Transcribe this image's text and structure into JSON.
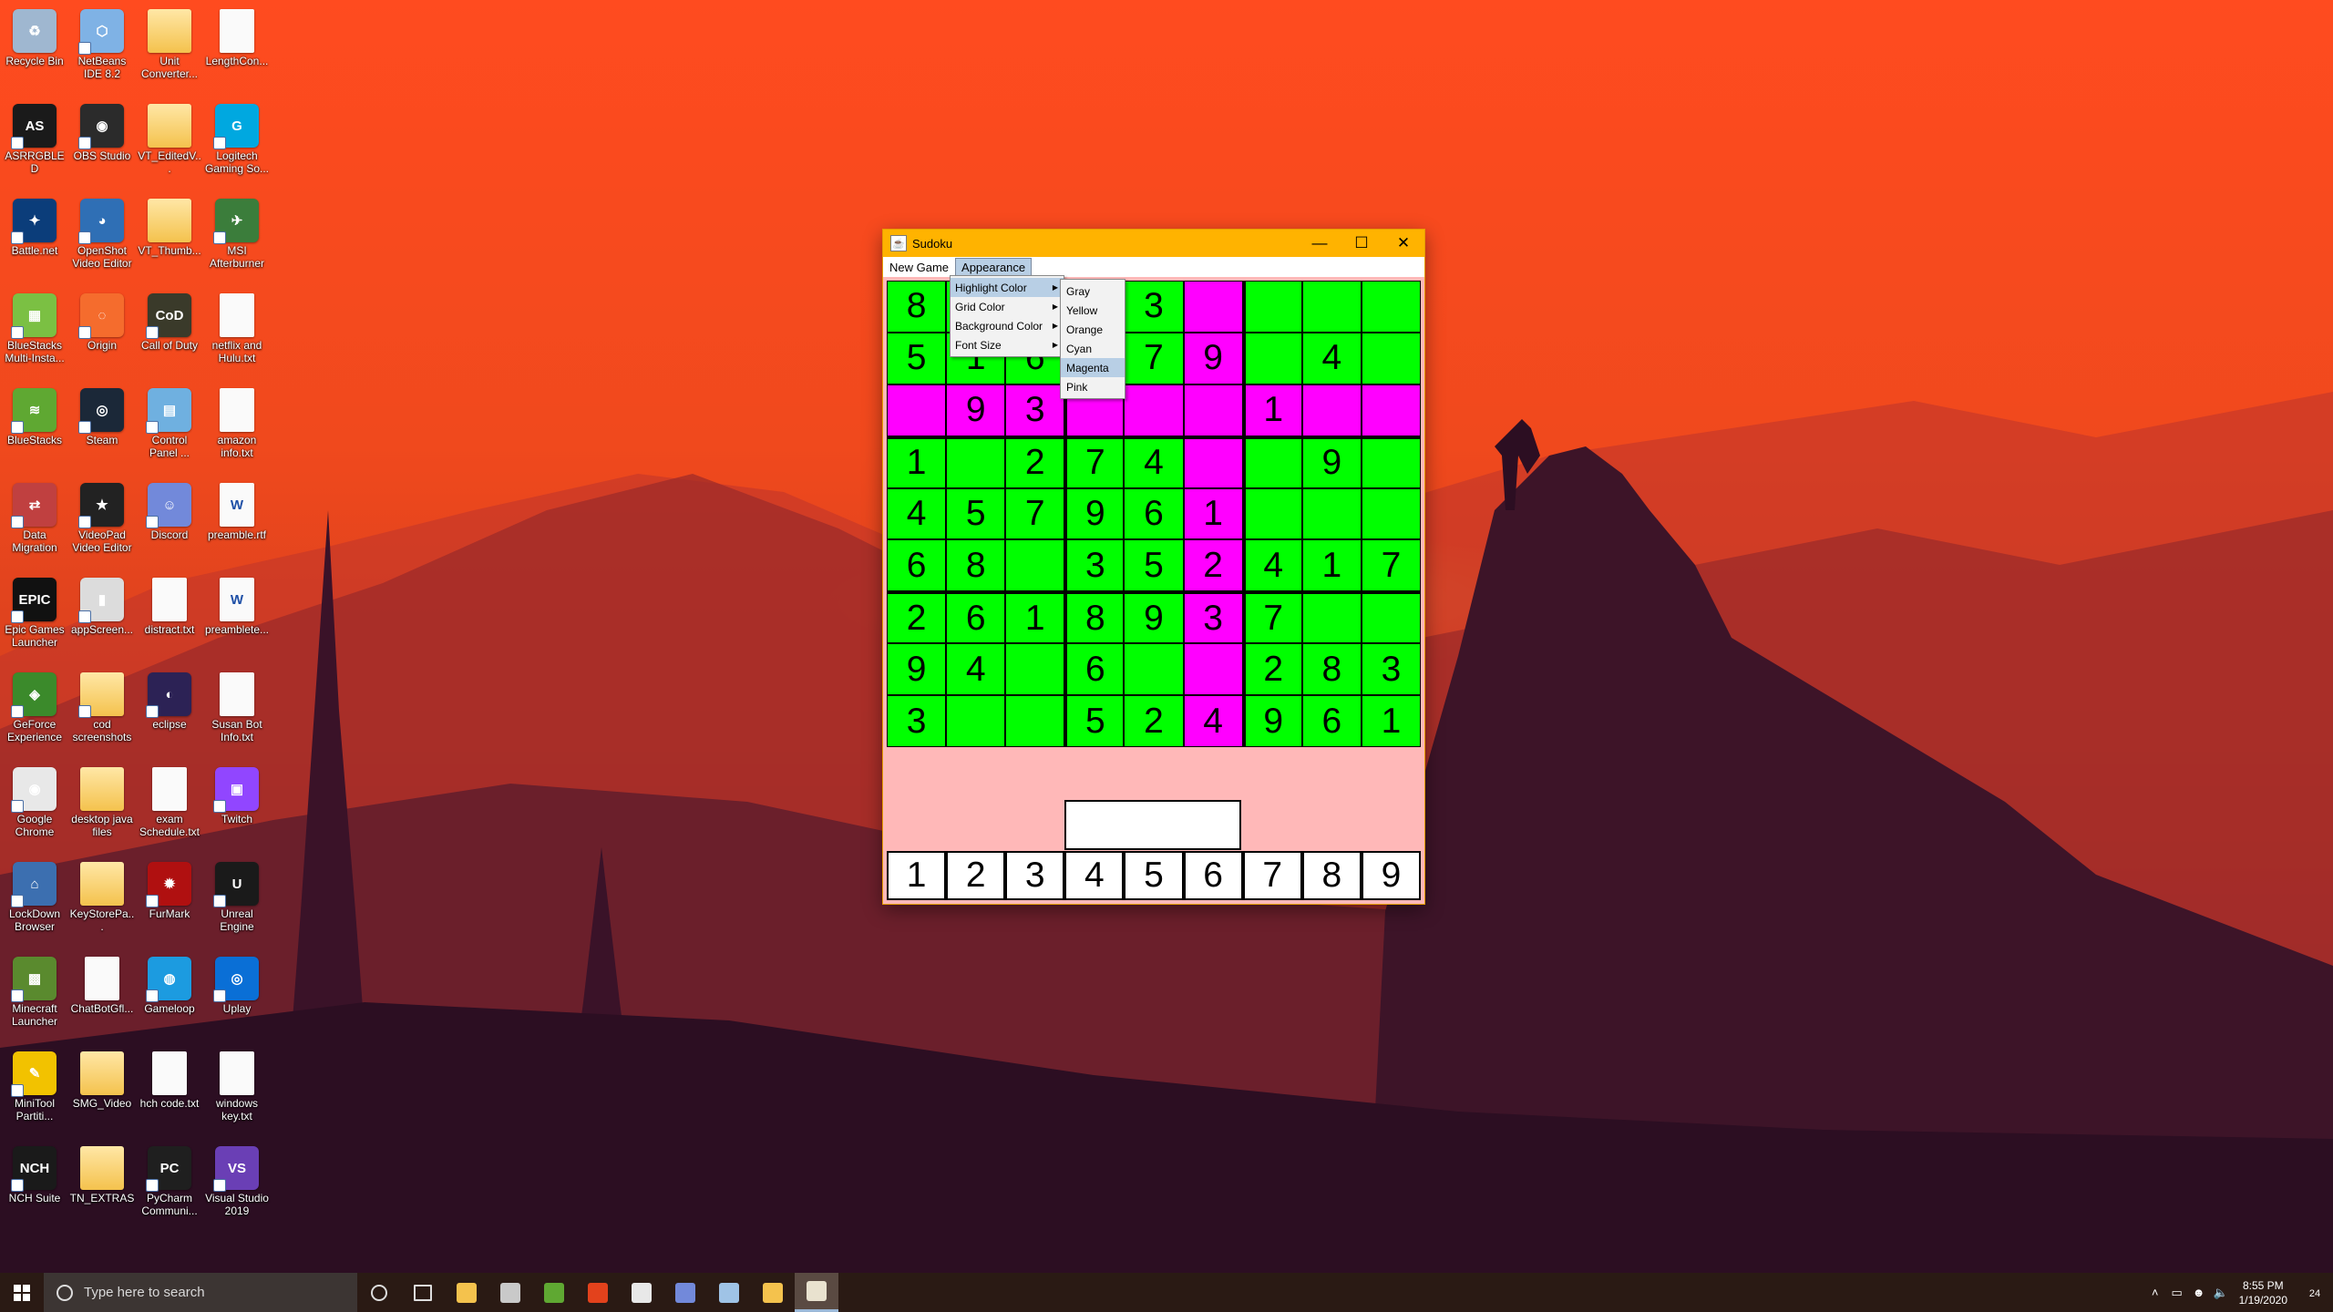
{
  "desktop_icons": [
    {
      "label": "Recycle Bin",
      "color": "#9fb7d0",
      "glyph": "♻",
      "shortcut": false
    },
    {
      "label": "NetBeans IDE 8.2",
      "color": "#7fb2e5",
      "glyph": "⬡",
      "shortcut": true
    },
    {
      "label": "Unit Converter...",
      "color": "folder",
      "glyph": "",
      "shortcut": false
    },
    {
      "label": "LengthCon...",
      "color": "doc",
      "glyph": "",
      "shortcut": false
    },
    {
      "label": "ASRRGBLED",
      "color": "#1a1a1a",
      "glyph": "AS",
      "shortcut": true
    },
    {
      "label": "OBS Studio",
      "color": "#2b2b2b",
      "glyph": "◉",
      "shortcut": true
    },
    {
      "label": "VT_EditedV...",
      "color": "folder",
      "glyph": "",
      "shortcut": false
    },
    {
      "label": "Logitech Gaming So...",
      "color": "#00a8e0",
      "glyph": "G",
      "shortcut": true
    },
    {
      "label": "Battle.net",
      "color": "#0b3d7a",
      "glyph": "✦",
      "shortcut": true
    },
    {
      "label": "OpenShot Video Editor",
      "color": "#2f6fb5",
      "glyph": "◕",
      "shortcut": true
    },
    {
      "label": "VT_Thumb...",
      "color": "folder",
      "glyph": "",
      "shortcut": false
    },
    {
      "label": "MSI Afterburner",
      "color": "#3b7d3b",
      "glyph": "✈",
      "shortcut": true
    },
    {
      "label": "BlueStacks Multi-Insta...",
      "color": "#7bc043",
      "glyph": "▦",
      "shortcut": true
    },
    {
      "label": "Origin",
      "color": "#f56c2d",
      "glyph": "◌",
      "shortcut": true
    },
    {
      "label": "Call of Duty",
      "color": "#3a3a2a",
      "glyph": "CoD",
      "shortcut": true
    },
    {
      "label": "netflix and Hulu.txt",
      "color": "doc",
      "glyph": "",
      "shortcut": false
    },
    {
      "label": "BlueStacks",
      "color": "#5fa832",
      "glyph": "≋",
      "shortcut": true
    },
    {
      "label": "Steam",
      "color": "#1b2838",
      "glyph": "◎",
      "shortcut": true
    },
    {
      "label": "Control Panel ...",
      "color": "#6fb0e0",
      "glyph": "▤",
      "shortcut": true
    },
    {
      "label": "amazon info.txt",
      "color": "doc",
      "glyph": "",
      "shortcut": false
    },
    {
      "label": "Data Migration",
      "color": "#c04040",
      "glyph": "⇄",
      "shortcut": true
    },
    {
      "label": "VideoPad Video Editor",
      "color": "#222",
      "glyph": "★",
      "shortcut": true
    },
    {
      "label": "Discord",
      "color": "#7289da",
      "glyph": "☺",
      "shortcut": true
    },
    {
      "label": "preamble.rtf",
      "color": "doc",
      "glyph": "W",
      "shortcut": false
    },
    {
      "label": "Epic Games Launcher",
      "color": "#111",
      "glyph": "EPIC",
      "shortcut": true
    },
    {
      "label": "appScreen...",
      "color": "#dcdcdc",
      "glyph": "▮",
      "shortcut": true
    },
    {
      "label": "distract.txt",
      "color": "doc",
      "glyph": "",
      "shortcut": false
    },
    {
      "label": "preamblete...",
      "color": "doc",
      "glyph": "W",
      "shortcut": false
    },
    {
      "label": "GeForce Experience",
      "color": "#3b8a2b",
      "glyph": "◈",
      "shortcut": true
    },
    {
      "label": "cod screenshots",
      "color": "folder",
      "glyph": "",
      "shortcut": true
    },
    {
      "label": "eclipse",
      "color": "#2c2255",
      "glyph": "◐",
      "shortcut": true
    },
    {
      "label": "Susan Bot Info.txt",
      "color": "doc",
      "glyph": "",
      "shortcut": false
    },
    {
      "label": "Google Chrome",
      "color": "#e8e8e8",
      "glyph": "◉",
      "shortcut": true
    },
    {
      "label": "desktop java files",
      "color": "folder",
      "glyph": "",
      "shortcut": false
    },
    {
      "label": "exam Schedule.txt",
      "color": "doc",
      "glyph": "",
      "shortcut": false
    },
    {
      "label": "Twitch",
      "color": "#9146ff",
      "glyph": "▣",
      "shortcut": true
    },
    {
      "label": "LockDown Browser",
      "color": "#3c6fb0",
      "glyph": "⌂",
      "shortcut": true
    },
    {
      "label": "KeyStorePa...",
      "color": "folder",
      "glyph": "",
      "shortcut": false
    },
    {
      "label": "FurMark",
      "color": "#b01010",
      "glyph": "✹",
      "shortcut": true
    },
    {
      "label": "Unreal Engine",
      "color": "#1a1a1a",
      "glyph": "U",
      "shortcut": true
    },
    {
      "label": "Minecraft Launcher",
      "color": "#5a8a2e",
      "glyph": "▩",
      "shortcut": true
    },
    {
      "label": "ChatBotGfl...",
      "color": "doc",
      "glyph": "",
      "shortcut": false
    },
    {
      "label": "Gameloop",
      "color": "#1c9be0",
      "glyph": "◍",
      "shortcut": true
    },
    {
      "label": "Uplay",
      "color": "#0a6fd6",
      "glyph": "◎",
      "shortcut": true
    },
    {
      "label": "MiniTool Partiti...",
      "color": "#f2c200",
      "glyph": "✎",
      "shortcut": true
    },
    {
      "label": "SMG_Video",
      "color": "folder",
      "glyph": "",
      "shortcut": false
    },
    {
      "label": "hch code.txt",
      "color": "doc",
      "glyph": "",
      "shortcut": false
    },
    {
      "label": "windows key.txt",
      "color": "doc",
      "glyph": "",
      "shortcut": false
    },
    {
      "label": "NCH Suite",
      "color": "#1a1a1a",
      "glyph": "NCH",
      "shortcut": true
    },
    {
      "label": "TN_EXTRAS",
      "color": "folder",
      "glyph": "",
      "shortcut": false
    },
    {
      "label": "PyCharm Communi...",
      "color": "#1f1f1f",
      "glyph": "PC",
      "shortcut": true
    },
    {
      "label": "Visual Studio 2019",
      "color": "#6a3fb5",
      "glyph": "VS",
      "shortcut": true
    }
  ],
  "window": {
    "title": "Sudoku",
    "title_color": "#ffb300",
    "controls": {
      "minimize": "—",
      "maximize": "☐",
      "close": "✕"
    },
    "menu": [
      "New Game",
      "Appearance"
    ]
  },
  "board": [
    [
      "8",
      "",
      "",
      "",
      "3",
      "",
      "",
      "",
      ""
    ],
    [
      "5",
      "1",
      "6",
      "",
      "7",
      "9",
      "",
      "4",
      ""
    ],
    [
      "",
      "9",
      "3",
      "",
      "",
      "",
      "1",
      "",
      ""
    ],
    [
      "1",
      "",
      "2",
      "7",
      "4",
      "",
      "",
      "9",
      ""
    ],
    [
      "4",
      "5",
      "7",
      "9",
      "6",
      "1",
      "",
      "",
      ""
    ],
    [
      "6",
      "8",
      "",
      "3",
      "5",
      "2",
      "4",
      "1",
      "7"
    ],
    [
      "2",
      "6",
      "1",
      "8",
      "9",
      "3",
      "7",
      "",
      ""
    ],
    [
      "9",
      "4",
      "",
      "6",
      "",
      "",
      "2",
      "8",
      "3"
    ],
    [
      "3",
      "",
      "",
      "5",
      "2",
      "4",
      "9",
      "6",
      "1"
    ]
  ],
  "colors": {
    "grid": "#00ff00",
    "highlight": "#ff00ff",
    "background": "#ffb8b8"
  },
  "highlight_row": 2,
  "highlight_col": 5,
  "number_buttons": [
    "1",
    "2",
    "3",
    "4",
    "5",
    "6",
    "7",
    "8",
    "9"
  ],
  "appearance_menu": [
    "Highlight Color",
    "Grid Color",
    "Background Color",
    "Font Size"
  ],
  "highlight_color_menu": [
    "Gray",
    "Yellow",
    "Orange",
    "Cyan",
    "Magenta",
    "Pink"
  ],
  "highlight_color_selected": "Magenta",
  "taskbar": {
    "search_placeholder": "Type here to search",
    "pinned": [
      {
        "name": "cortana",
        "color": "transparent"
      },
      {
        "name": "task-view",
        "color": "transparent"
      },
      {
        "name": "file-explorer",
        "color": "#f4c24d"
      },
      {
        "name": "app-1",
        "color": "#c9c9c9"
      },
      {
        "name": "app-2",
        "color": "#5fa832"
      },
      {
        "name": "office",
        "color": "#e3421c"
      },
      {
        "name": "chrome",
        "color": "#e8e8e8"
      },
      {
        "name": "discord",
        "color": "#7289da"
      },
      {
        "name": "app-3",
        "color": "#9fc3e6"
      },
      {
        "name": "app-4",
        "color": "#f4c24d"
      },
      {
        "name": "java-app",
        "color": "#e9e2cf"
      }
    ],
    "time": "8:55 PM",
    "date": "1/19/2020",
    "notification_count": "24"
  }
}
